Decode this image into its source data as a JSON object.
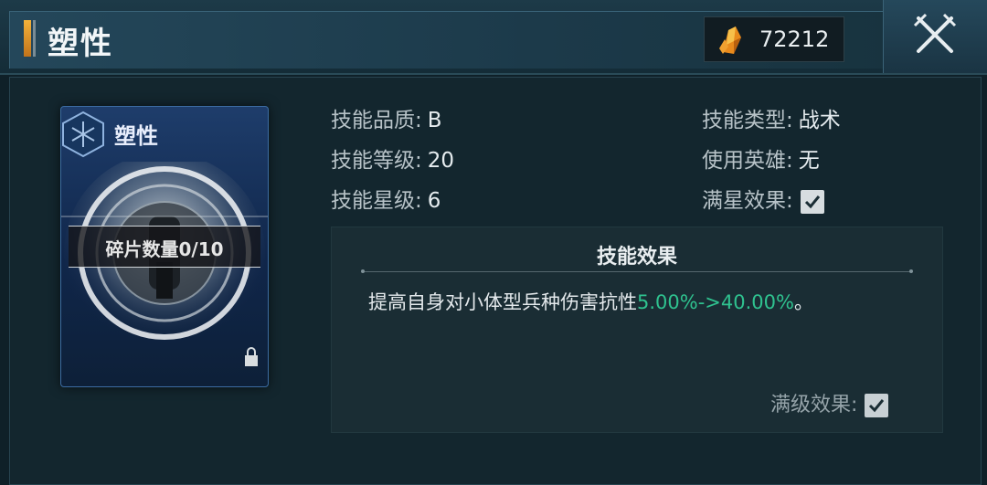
{
  "header": {
    "title": "塑性",
    "currency": {
      "icon": "crystal-icon",
      "value": "72212"
    },
    "close_icon": "close-swords-icon"
  },
  "card": {
    "name": "塑性",
    "fragment_label": "碎片数量0/10"
  },
  "stats": {
    "quality_label": "技能品质:",
    "quality_value": "B",
    "level_label": "技能等级:",
    "level_value": "20",
    "star_label": "技能星级:",
    "star_value": "6",
    "type_label": "技能类型:",
    "type_value": "战术",
    "hero_label": "使用英雄:",
    "hero_value": "无",
    "max_star_label": "满星效果:",
    "max_star_checked": true
  },
  "effect": {
    "title": "技能效果",
    "desc_prefix": "提高自身对小体型兵种伤害抗性",
    "desc_highlight": "5.00%->40.00%",
    "desc_suffix": "。",
    "max_level_label": "满级效果:",
    "max_level_checked": true
  },
  "colors": {
    "highlight": "#2fc28f",
    "accent": "#f4b23a",
    "card_blue": "#1e3d6b"
  }
}
